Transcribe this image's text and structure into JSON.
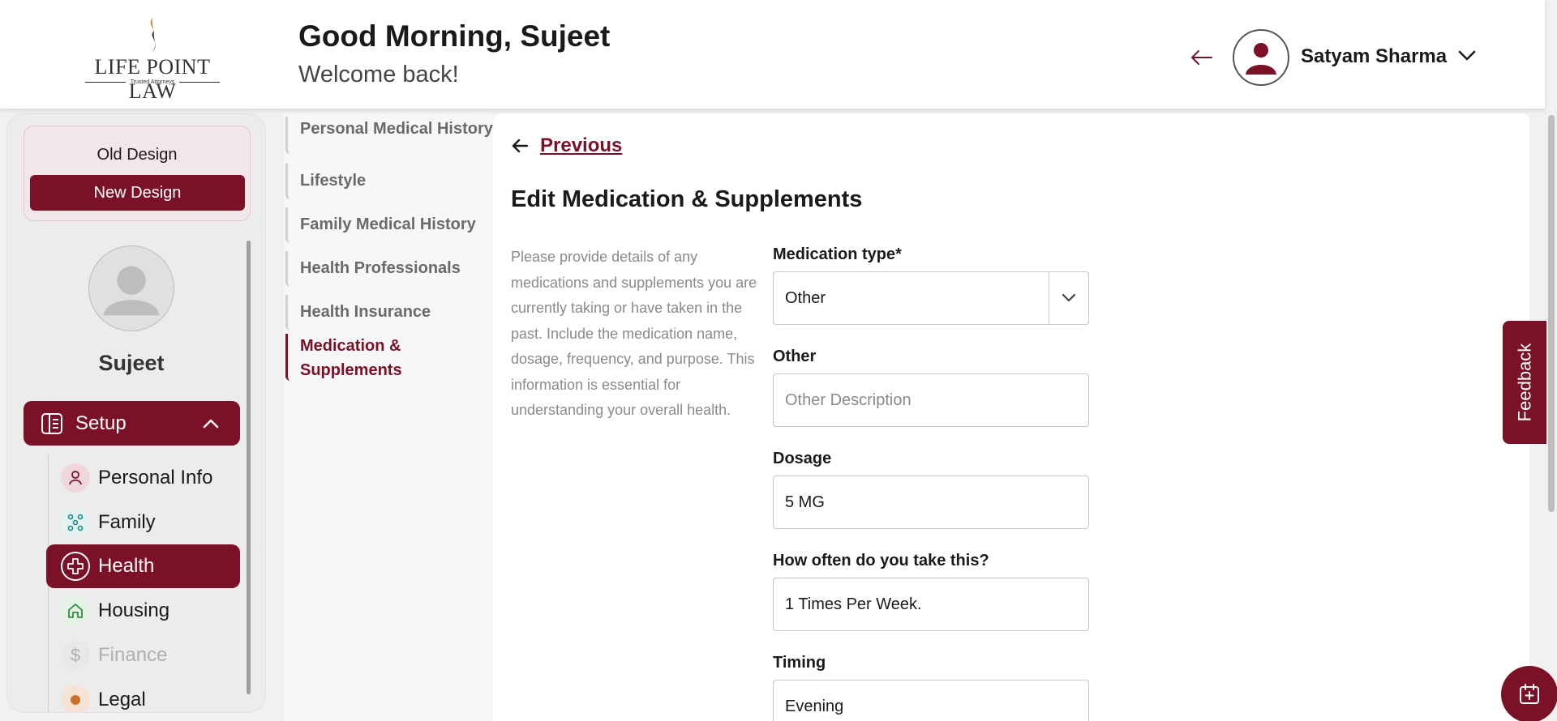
{
  "header": {
    "logo": {
      "name": "LIFE POINT LAW",
      "tagline": "Trusted Attorneys"
    },
    "greeting": "Good Morning, Sujeet",
    "welcome": "Welcome back!",
    "user_name": "Satyam Sharma"
  },
  "sidebar": {
    "old_design": "Old Design",
    "new_design": "New Design",
    "profile_name": "Sujeet",
    "setup_label": "Setup",
    "items": [
      {
        "label": "Personal Info",
        "icon": "person-icon",
        "state": "normal"
      },
      {
        "label": "Family",
        "icon": "family-icon",
        "state": "normal"
      },
      {
        "label": "Health",
        "icon": "health-plus-icon",
        "state": "active"
      },
      {
        "label": "Housing",
        "icon": "house-icon",
        "state": "normal"
      },
      {
        "label": "Finance",
        "icon": "dollar-icon",
        "state": "disabled"
      },
      {
        "label": "Legal",
        "icon": "legal-icon",
        "state": "normal"
      }
    ]
  },
  "subnav": {
    "items": [
      {
        "label": "Personal Medical History"
      },
      {
        "label": "Lifestyle"
      },
      {
        "label": "Family Medical History"
      },
      {
        "label": "Health Professionals"
      },
      {
        "label": "Health Insurance"
      },
      {
        "label": "Medication & Supplements",
        "line1": "Medication &",
        "line2": "Supplements",
        "active": true
      }
    ]
  },
  "main": {
    "previous": "Previous",
    "title": "Edit Medication & Supplements",
    "description": "Please provide details of any medications and supplements you are currently taking or have taken in the past. Include the medication name, dosage, frequency, and purpose. This information is essential for understanding your overall health.",
    "fields": {
      "medication_type": {
        "label": "Medication type*",
        "value": "Other"
      },
      "other": {
        "label": "Other",
        "placeholder": "Other Description"
      },
      "dosage": {
        "label": "Dosage",
        "value": "5 MG"
      },
      "frequency": {
        "label": "How often do you take this?",
        "value": "1 Times Per Week."
      },
      "timing": {
        "label": "Timing",
        "value": "Evening"
      }
    }
  },
  "feedback": "Feedback",
  "colors": {
    "brand": "#7b1126",
    "teal": "#1a8a8a",
    "green": "#2e8b3d"
  }
}
